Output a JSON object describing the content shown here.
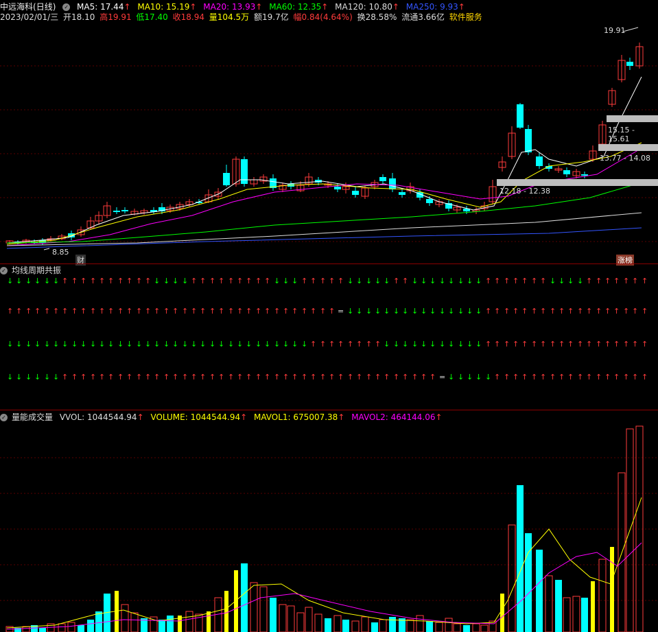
{
  "header": {
    "stock_name": "中远海科",
    "period": "(日线)",
    "ma": [
      {
        "label": "MA5: 17.44",
        "color": "#ffffff"
      },
      {
        "label": "MA10: 15.19",
        "color": "#ffff00"
      },
      {
        "label": "MA20: 13.93",
        "color": "#ff00ff"
      },
      {
        "label": "MA60: 12.35",
        "color": "#00ff00"
      },
      {
        "label": "MA120: 10.80",
        "color": "#dddddd"
      },
      {
        "label": "MA250: 9.93",
        "color": "#3355ff"
      }
    ],
    "up_arrow": "↑",
    "date": "2023/02/01/三",
    "open": "开18.10",
    "high": "高19.91",
    "low": "低17.40",
    "close": "收18.94",
    "vol": "量104.5万",
    "amount": "额19.7亿",
    "amp": "幅0.84(4.64%)",
    "turnover": "换28.58%",
    "float": "流通3.66亿",
    "industry": "软件服务"
  },
  "price_panel": {
    "high_label": "19.91",
    "low_label": "8.85",
    "zone1": "15.15 - 15.61",
    "zone2": "13.77 - 14.08",
    "zone3": "12.18 - 12.38",
    "tag_left": "财",
    "tag_right": "涨榜"
  },
  "indicator1": {
    "title": "均线周期共振"
  },
  "volume_panel": {
    "title": "量能成交量",
    "vvol": "VVOL: 1044544.94",
    "volume": "VOLUME: 1044544.94",
    "mavol1": "MAVOL1: 675007.38",
    "mavol2": "MAVOL2: 464144.06",
    "up_arrow": "↑"
  },
  "colors": {
    "up": "#ff3b3b",
    "down": "#00ffff",
    "ma5": "#ffffff",
    "ma10": "#ffff00",
    "ma20": "#ff00ff",
    "ma60": "#00ff00",
    "ma120": "#dddddd",
    "ma250": "#3355ff",
    "vol_yellow": "#ffff00"
  }
}
